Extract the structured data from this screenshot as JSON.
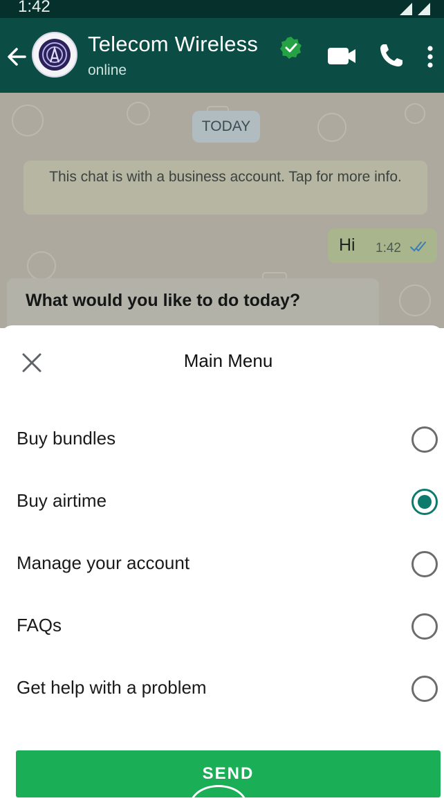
{
  "status_bar": {
    "time": "1:42"
  },
  "header": {
    "contact_name": "Telecom Wireless",
    "contact_status": "online",
    "icons": [
      "back-arrow-icon",
      "avatar",
      "verified-icon",
      "video-call-icon",
      "voice-call-icon",
      "more-options-icon"
    ],
    "colors": {
      "header_bg": "#0b4d45",
      "verified": "#25a244"
    }
  },
  "chat": {
    "date_chip": "TODAY",
    "system_note": "This chat is with a business account. Tap for more info.",
    "outgoing": {
      "text": "Hi",
      "time": "1:42",
      "read_icon": "double-check-icon"
    },
    "incoming": {
      "text": "What would you like to do today?"
    }
  },
  "sheet": {
    "title": "Main Menu",
    "options": [
      {
        "label": "Buy bundles",
        "selected": false
      },
      {
        "label": "Buy airtime",
        "selected": true
      },
      {
        "label": "Manage your account",
        "selected": false
      },
      {
        "label": "FAQs",
        "selected": false
      },
      {
        "label": "Get help with a problem",
        "selected": false
      }
    ],
    "send_label": "SEND",
    "colors": {
      "accent": "#0c7a6d",
      "send": "#1aae56"
    }
  }
}
